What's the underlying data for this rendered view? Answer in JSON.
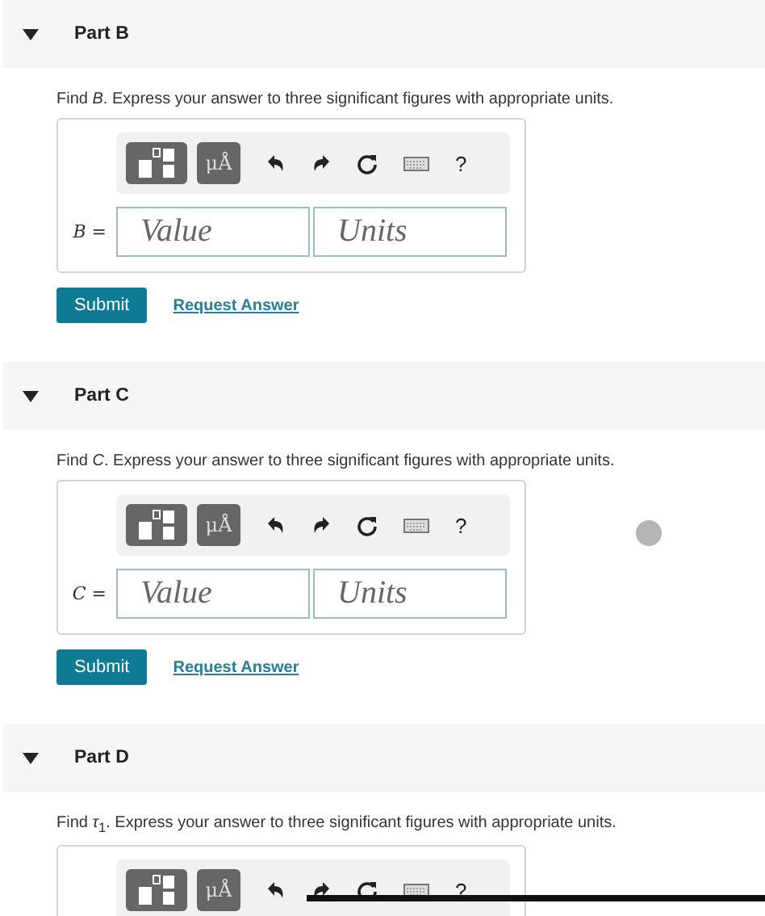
{
  "parts": [
    {
      "title": "Part B",
      "expanded": true,
      "prompt": "Find *B*. Express your answer to three significant figures with appropriate units.",
      "toolbar": {
        "units_button": "μÅ",
        "help": "?"
      },
      "answer": {
        "label": "B =",
        "value_placeholder": "Value",
        "units_placeholder": "Units"
      },
      "submit": "Submit",
      "request_answer": "Request Answer"
    },
    {
      "title": "Part C",
      "expanded": true,
      "prompt": "Find *C*. Express your answer to three significant figures with appropriate units.",
      "toolbar": {
        "units_button": "μÅ",
        "help": "?"
      },
      "answer": {
        "label": "C =",
        "value_placeholder": "Value",
        "units_placeholder": "Units"
      },
      "submit": "Submit",
      "request_answer": "Request Answer"
    },
    {
      "title": "Part D",
      "expanded": true,
      "prompt": "Find *τ*$_{1}$. Express your answer to three significant figures with appropriate units.",
      "toolbar": {
        "units_button": "μÅ",
        "help": "?"
      }
    }
  ]
}
